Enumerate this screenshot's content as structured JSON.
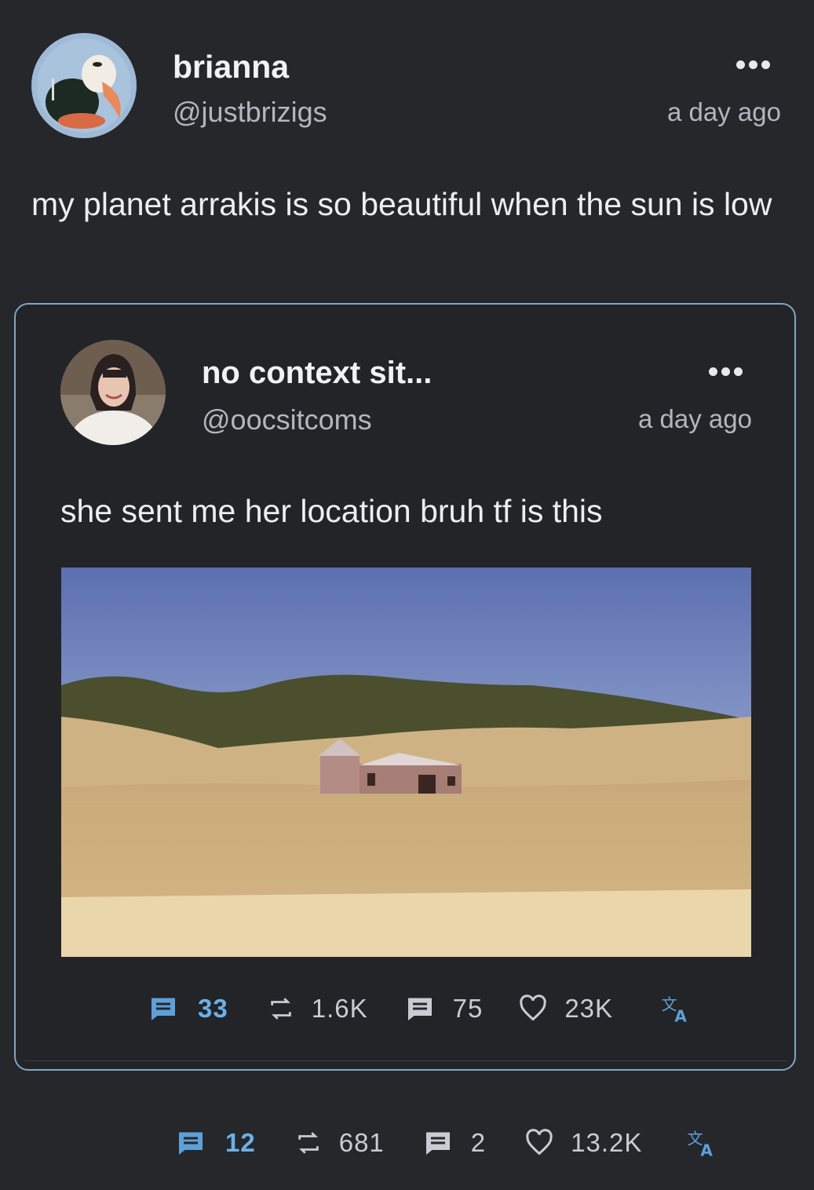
{
  "post": {
    "author_name": "brianna",
    "handle": "@justbrizigs",
    "time": "a day ago",
    "text": "my planet arrakis is so beautiful when the sun is low",
    "stats": {
      "comments": "12",
      "reposts": "681",
      "quotes": "2",
      "likes": "13.2K"
    }
  },
  "quoted": {
    "author_name": "no context sit...",
    "handle": "@oocsitcoms",
    "time": "a day ago",
    "text": "she sent me her location bruh tf is this",
    "stats": {
      "comments": "33",
      "reposts": "1.6K",
      "quotes": "75",
      "likes": "23K"
    }
  },
  "colors": {
    "background": "#25272b",
    "accent_blue": "#5ea0d8",
    "quote_border": "#7ea6c2"
  },
  "icons": [
    "comment-icon",
    "repost-icon",
    "quote-icon",
    "heart-icon",
    "translate-icon",
    "more-icon"
  ]
}
